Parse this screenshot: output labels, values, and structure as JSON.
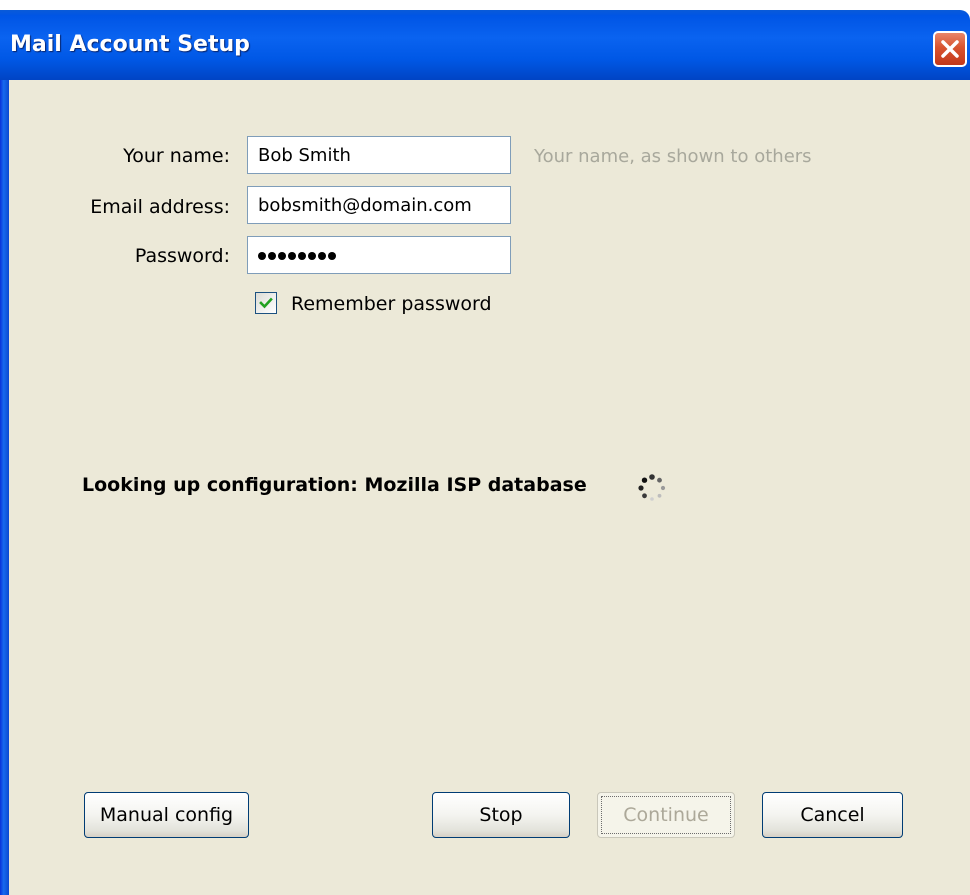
{
  "window": {
    "title": "Mail Account Setup"
  },
  "form": {
    "name_label": "Your name:",
    "name_value": "Bob Smith",
    "name_hint": "Your name, as shown to others",
    "email_label": "Email address:",
    "email_value": "bobsmith@domain.com",
    "password_label": "Password:",
    "password_dot_count": 8,
    "remember_label": "Remember password",
    "remember_checked": true
  },
  "status": {
    "text": "Looking up configuration: Mozilla ISP database"
  },
  "buttons": {
    "manual_config": "Manual config",
    "stop": "Stop",
    "continue": "Continue",
    "continue_enabled": false,
    "cancel": "Cancel"
  },
  "icons": {
    "close": "close-icon",
    "check": "checkmark-icon",
    "spinner": "loading-spinner-icon"
  },
  "colors": {
    "titlebar": "#0058e6",
    "client_background": "#ece9d8",
    "close_button": "#d8532f",
    "hint_text": "#a8a89c",
    "checkmark": "#21a121"
  }
}
